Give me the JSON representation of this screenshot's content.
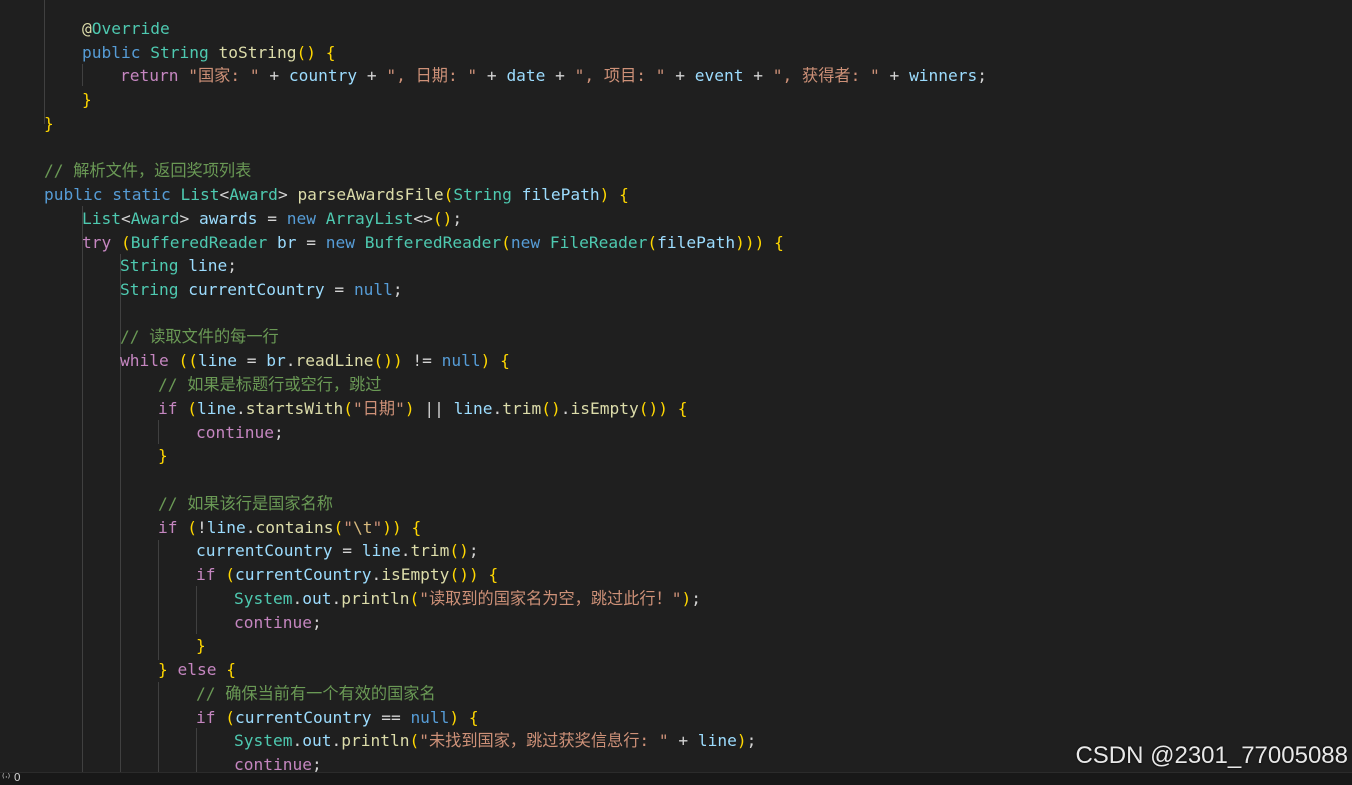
{
  "editor": {
    "code_lines": [
      "@Override",
      "public String toString() {",
      "return \"国家: \" + country + \", 日期: \" + date + \", 项目: \" + event + \", 获得者: \" + winners;",
      "}",
      "}",
      "",
      "// 解析文件，返回奖项列表",
      "public static List<Award> parseAwardsFile(String filePath) {",
      "List<Award> awards = new ArrayList<>();",
      "try (BufferedReader br = new BufferedReader(new FileReader(filePath))) {",
      "String line;",
      "String currentCountry = null;",
      "",
      "// 读取文件的每一行",
      "while ((line = br.readLine()) != null) {",
      "// 如果是标题行或空行，跳过",
      "if (line.startsWith(\"日期\") || line.trim().isEmpty()) {",
      "continue;",
      "}",
      "",
      "// 如果该行是国家名称",
      "if (!line.contains(\"\\t\")) {",
      "currentCountry = line.trim();",
      "if (currentCountry.isEmpty()) {",
      "System.out.println(\"读取到的国家名为空，跳过此行！\");",
      "continue;",
      "}",
      "} else {",
      "// 确保当前有一个有效的国家名",
      "if (currentCountry == null) {",
      "System.out.println(\"未找到国家，跳过获奖信息行: \" + line);",
      "continue;"
    ]
  },
  "watermark": "CSDN @2301_77005088",
  "status": {
    "icon_text": "⁽ᐧ⁾ 0"
  },
  "colors": {
    "background": "#1f1f1f",
    "keyword": "#569cd6",
    "control": "#c586c0",
    "type": "#4ec9b0",
    "function": "#dcdcaa",
    "variable": "#9cdcfe",
    "string": "#ce9178",
    "comment": "#6a9955"
  }
}
